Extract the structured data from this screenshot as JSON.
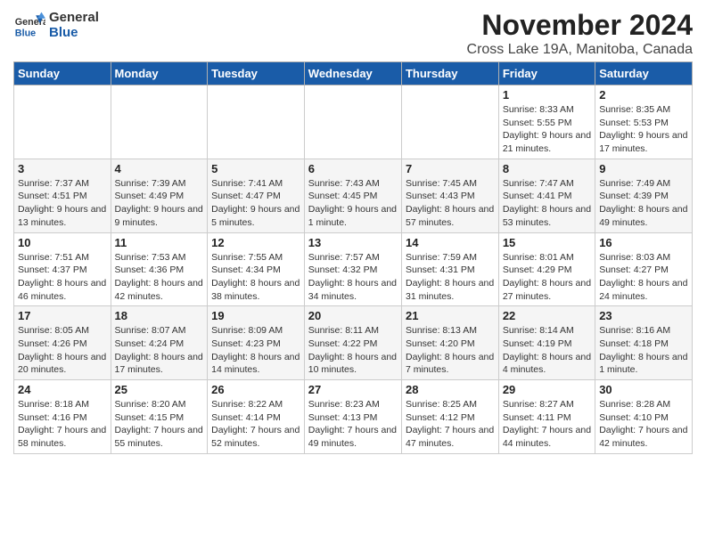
{
  "logo": {
    "line1": "General",
    "line2": "Blue"
  },
  "title": "November 2024",
  "subtitle": "Cross Lake 19A, Manitoba, Canada",
  "weekdays": [
    "Sunday",
    "Monday",
    "Tuesday",
    "Wednesday",
    "Thursday",
    "Friday",
    "Saturday"
  ],
  "weeks": [
    [
      {
        "day": "",
        "info": ""
      },
      {
        "day": "",
        "info": ""
      },
      {
        "day": "",
        "info": ""
      },
      {
        "day": "",
        "info": ""
      },
      {
        "day": "",
        "info": ""
      },
      {
        "day": "1",
        "info": "Sunrise: 8:33 AM\nSunset: 5:55 PM\nDaylight: 9 hours and 21 minutes."
      },
      {
        "day": "2",
        "info": "Sunrise: 8:35 AM\nSunset: 5:53 PM\nDaylight: 9 hours and 17 minutes."
      }
    ],
    [
      {
        "day": "3",
        "info": "Sunrise: 7:37 AM\nSunset: 4:51 PM\nDaylight: 9 hours and 13 minutes."
      },
      {
        "day": "4",
        "info": "Sunrise: 7:39 AM\nSunset: 4:49 PM\nDaylight: 9 hours and 9 minutes."
      },
      {
        "day": "5",
        "info": "Sunrise: 7:41 AM\nSunset: 4:47 PM\nDaylight: 9 hours and 5 minutes."
      },
      {
        "day": "6",
        "info": "Sunrise: 7:43 AM\nSunset: 4:45 PM\nDaylight: 9 hours and 1 minute."
      },
      {
        "day": "7",
        "info": "Sunrise: 7:45 AM\nSunset: 4:43 PM\nDaylight: 8 hours and 57 minutes."
      },
      {
        "day": "8",
        "info": "Sunrise: 7:47 AM\nSunset: 4:41 PM\nDaylight: 8 hours and 53 minutes."
      },
      {
        "day": "9",
        "info": "Sunrise: 7:49 AM\nSunset: 4:39 PM\nDaylight: 8 hours and 49 minutes."
      }
    ],
    [
      {
        "day": "10",
        "info": "Sunrise: 7:51 AM\nSunset: 4:37 PM\nDaylight: 8 hours and 46 minutes."
      },
      {
        "day": "11",
        "info": "Sunrise: 7:53 AM\nSunset: 4:36 PM\nDaylight: 8 hours and 42 minutes."
      },
      {
        "day": "12",
        "info": "Sunrise: 7:55 AM\nSunset: 4:34 PM\nDaylight: 8 hours and 38 minutes."
      },
      {
        "day": "13",
        "info": "Sunrise: 7:57 AM\nSunset: 4:32 PM\nDaylight: 8 hours and 34 minutes."
      },
      {
        "day": "14",
        "info": "Sunrise: 7:59 AM\nSunset: 4:31 PM\nDaylight: 8 hours and 31 minutes."
      },
      {
        "day": "15",
        "info": "Sunrise: 8:01 AM\nSunset: 4:29 PM\nDaylight: 8 hours and 27 minutes."
      },
      {
        "day": "16",
        "info": "Sunrise: 8:03 AM\nSunset: 4:27 PM\nDaylight: 8 hours and 24 minutes."
      }
    ],
    [
      {
        "day": "17",
        "info": "Sunrise: 8:05 AM\nSunset: 4:26 PM\nDaylight: 8 hours and 20 minutes."
      },
      {
        "day": "18",
        "info": "Sunrise: 8:07 AM\nSunset: 4:24 PM\nDaylight: 8 hours and 17 minutes."
      },
      {
        "day": "19",
        "info": "Sunrise: 8:09 AM\nSunset: 4:23 PM\nDaylight: 8 hours and 14 minutes."
      },
      {
        "day": "20",
        "info": "Sunrise: 8:11 AM\nSunset: 4:22 PM\nDaylight: 8 hours and 10 minutes."
      },
      {
        "day": "21",
        "info": "Sunrise: 8:13 AM\nSunset: 4:20 PM\nDaylight: 8 hours and 7 minutes."
      },
      {
        "day": "22",
        "info": "Sunrise: 8:14 AM\nSunset: 4:19 PM\nDaylight: 8 hours and 4 minutes."
      },
      {
        "day": "23",
        "info": "Sunrise: 8:16 AM\nSunset: 4:18 PM\nDaylight: 8 hours and 1 minute."
      }
    ],
    [
      {
        "day": "24",
        "info": "Sunrise: 8:18 AM\nSunset: 4:16 PM\nDaylight: 7 hours and 58 minutes."
      },
      {
        "day": "25",
        "info": "Sunrise: 8:20 AM\nSunset: 4:15 PM\nDaylight: 7 hours and 55 minutes."
      },
      {
        "day": "26",
        "info": "Sunrise: 8:22 AM\nSunset: 4:14 PM\nDaylight: 7 hours and 52 minutes."
      },
      {
        "day": "27",
        "info": "Sunrise: 8:23 AM\nSunset: 4:13 PM\nDaylight: 7 hours and 49 minutes."
      },
      {
        "day": "28",
        "info": "Sunrise: 8:25 AM\nSunset: 4:12 PM\nDaylight: 7 hours and 47 minutes."
      },
      {
        "day": "29",
        "info": "Sunrise: 8:27 AM\nSunset: 4:11 PM\nDaylight: 7 hours and 44 minutes."
      },
      {
        "day": "30",
        "info": "Sunrise: 8:28 AM\nSunset: 4:10 PM\nDaylight: 7 hours and 42 minutes."
      }
    ]
  ]
}
